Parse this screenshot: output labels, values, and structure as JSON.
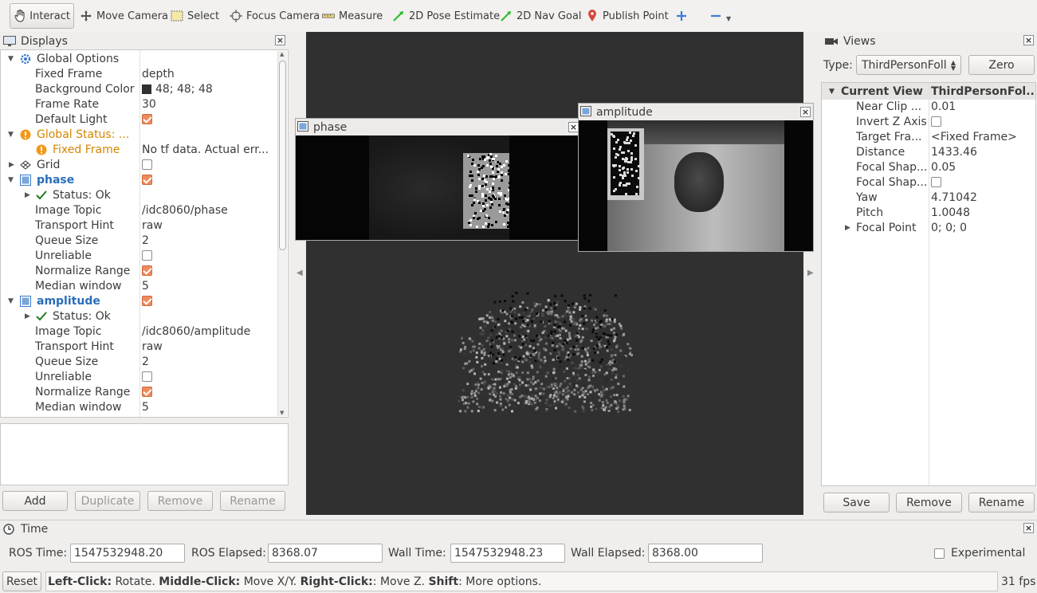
{
  "toolbar": {
    "interact": "Interact",
    "move_camera": "Move Camera",
    "select": "Select",
    "focus_camera": "Focus Camera",
    "measure": "Measure",
    "pose_estimate": "2D Pose Estimate",
    "nav_goal": "2D Nav Goal",
    "publish_point": "Publish Point"
  },
  "displays": {
    "title": "Displays",
    "rows": {
      "global_options": "Global Options",
      "fixed_frame": "Fixed Frame",
      "fixed_frame_val": "depth",
      "background_color": "Background Color",
      "background_color_val": "48; 48; 48",
      "frame_rate": "Frame Rate",
      "frame_rate_val": "30",
      "default_light": "Default Light",
      "global_status": "Global Status: ...",
      "gs_fixed_frame": "Fixed Frame",
      "gs_fixed_frame_val": "No tf data.  Actual err...",
      "grid": "Grid",
      "phase": "phase",
      "phase_status": "Status: Ok",
      "phase_topic": "Image Topic",
      "phase_topic_val": "/idc8060/phase",
      "phase_hint": "Transport Hint",
      "phase_hint_val": "raw",
      "phase_queue": "Queue Size",
      "phase_queue_val": "2",
      "phase_unrel": "Unreliable",
      "phase_norm": "Normalize Range",
      "phase_median": "Median window",
      "phase_median_val": "5",
      "amplitude": "amplitude",
      "amp_status": "Status: Ok",
      "amp_topic": "Image Topic",
      "amp_topic_val": "/idc8060/amplitude",
      "amp_hint": "Transport Hint",
      "amp_hint_val": "raw",
      "amp_queue": "Queue Size",
      "amp_queue_val": "2",
      "amp_unrel": "Unreliable",
      "amp_norm": "Normalize Range",
      "amp_median": "Median window",
      "amp_median_val": "5"
    },
    "buttons": {
      "add": "Add",
      "duplicate": "Duplicate",
      "remove": "Remove",
      "rename": "Rename"
    }
  },
  "image_windows": {
    "phase_title": "phase",
    "amplitude_title": "amplitude"
  },
  "views": {
    "title": "Views",
    "type_label": "Type:",
    "type_value": "ThirdPersonFoll",
    "zero": "Zero",
    "header_name": "Current View",
    "header_value": "ThirdPersonFol...",
    "rows": {
      "near_clip": "Near Clip ...",
      "near_clip_val": "0.01",
      "invert_z": "Invert Z Axis",
      "target_frame": "Target Fra...",
      "target_frame_val": "<Fixed Frame>",
      "distance": "Distance",
      "distance_val": "1433.46",
      "focal_shape_size": "Focal Shap...",
      "focal_shape_size_val": "0.05",
      "focal_shape_fixed": "Focal Shap...",
      "yaw": "Yaw",
      "yaw_val": "4.71042",
      "pitch": "Pitch",
      "pitch_val": "1.0048",
      "focal_point": "Focal Point",
      "focal_point_val": "0; 0; 0"
    },
    "buttons": {
      "save": "Save",
      "remove": "Remove",
      "rename": "Rename"
    }
  },
  "time": {
    "title": "Time",
    "ros_time_label": "ROS Time:",
    "ros_time": "1547532948.20",
    "ros_elapsed_label": "ROS Elapsed:",
    "ros_elapsed": "8368.07",
    "wall_time_label": "Wall Time:",
    "wall_time": "1547532948.23",
    "wall_elapsed_label": "Wall Elapsed:",
    "wall_elapsed": "8368.00",
    "experimental": "Experimental"
  },
  "status": {
    "reset": "Reset",
    "left_click": "Left-Click:",
    "left_action": " Rotate. ",
    "middle_click": "Middle-Click:",
    "middle_action": " Move X/Y. ",
    "right_click": "Right-Click:",
    "right_action": ": Move Z. ",
    "shift": "Shift",
    "shift_action": ": More options.",
    "fps": "31 fps"
  },
  "colors": {
    "viewport_bg": "#303030",
    "checkbox_on": "#ef8a5b",
    "link_blue": "#2a6ebb",
    "warn": "#d48600"
  }
}
